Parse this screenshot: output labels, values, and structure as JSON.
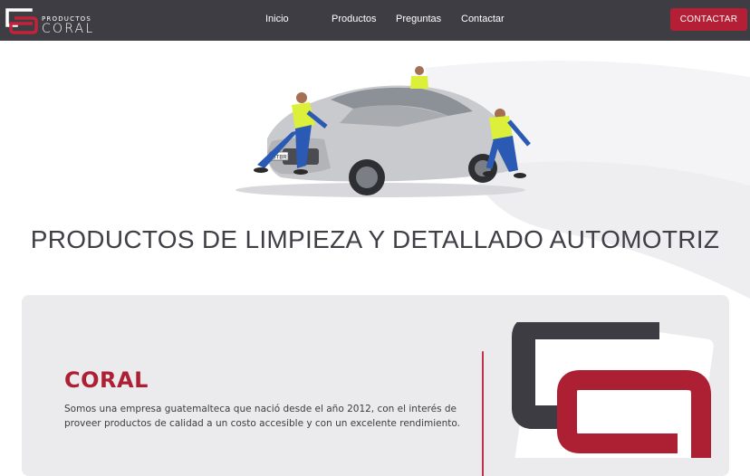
{
  "header": {
    "logo_small": "PRODUCTOS",
    "logo_big": "CORAL",
    "nav": [
      {
        "label": "Inicio"
      },
      {
        "label": "Productos"
      },
      {
        "label": "Preguntas"
      },
      {
        "label": "Contactar"
      }
    ],
    "cta_label": "CONTACTAR"
  },
  "hero": {
    "title": "PRODUCTOS DE LIMPIEZA Y DETALLADO AUTOMOTRIZ",
    "plate_text": "GTBR"
  },
  "about": {
    "heading": "CORAL",
    "text": "Somos una empresa guatemalteca que nació desde el año 2012, con el interés de proveer productos de calidad a un costo accesible y con un excelente rendimiento."
  },
  "colors": {
    "nav_bg": "#3e3d44",
    "accent": "#b51f36",
    "card_bg": "#ebebee"
  }
}
